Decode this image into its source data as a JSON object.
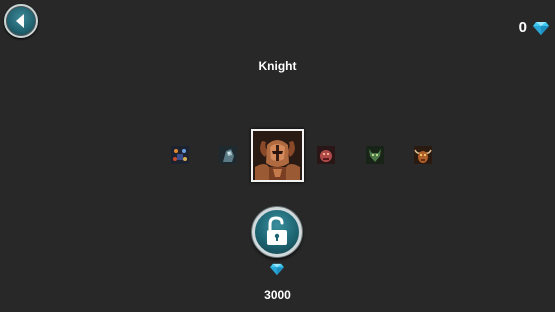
{
  "gems": {
    "count": "0",
    "icon": "diamond-icon",
    "color": "#3fc6f0"
  },
  "character": {
    "name": "Knight"
  },
  "roster": [
    {
      "id": "sorcerer",
      "icon": "sorcerer-portrait"
    },
    {
      "id": "shadow",
      "icon": "shadow-warrior-portrait"
    },
    {
      "id": "knight",
      "icon": "knight-portrait",
      "selected": true
    },
    {
      "id": "berserker",
      "icon": "red-beast-portrait"
    },
    {
      "id": "orc",
      "icon": "green-orc-portrait"
    },
    {
      "id": "minotaur",
      "icon": "minotaur-portrait"
    }
  ],
  "unlock": {
    "price": "3000",
    "icon": "unlock-icon",
    "currency_icon": "diamond-icon"
  },
  "colors": {
    "background": "#282828",
    "button": "#1d6573",
    "accent": "#3fc6f0"
  }
}
